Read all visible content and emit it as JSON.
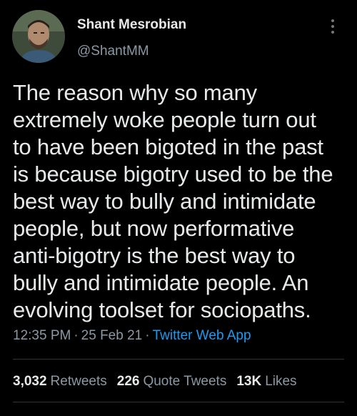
{
  "author": {
    "display_name": "Shant Mesrobian",
    "handle": "@ShantMM",
    "avatar_icon": "profile-photo"
  },
  "tweet": {
    "text": "The reason why so many\nextremely woke people turn out\nto have been bigoted in the past\nis because bigotry used to be the\nbest way to bully and intimidate\npeople, but now performative\nanti-bigotry is the best way to\nbully and intimidate people. An\nevolving toolset for sociopaths."
  },
  "meta": {
    "time": "12:35 PM",
    "separator1": "·",
    "date": "25 Feb 21",
    "separator2": "·",
    "app": "Twitter Web App"
  },
  "stats": {
    "retweets_count": "3,032",
    "retweets_label": "Retweets",
    "quotes_count": "226",
    "quotes_label": "Quote Tweets",
    "likes_count": "13K",
    "likes_label": "Likes"
  },
  "colors": {
    "background": "#000000",
    "text": "#e7e9ea",
    "secondary": "#8b98a5",
    "link": "#1d9bf0",
    "divider": "#2f3336"
  }
}
